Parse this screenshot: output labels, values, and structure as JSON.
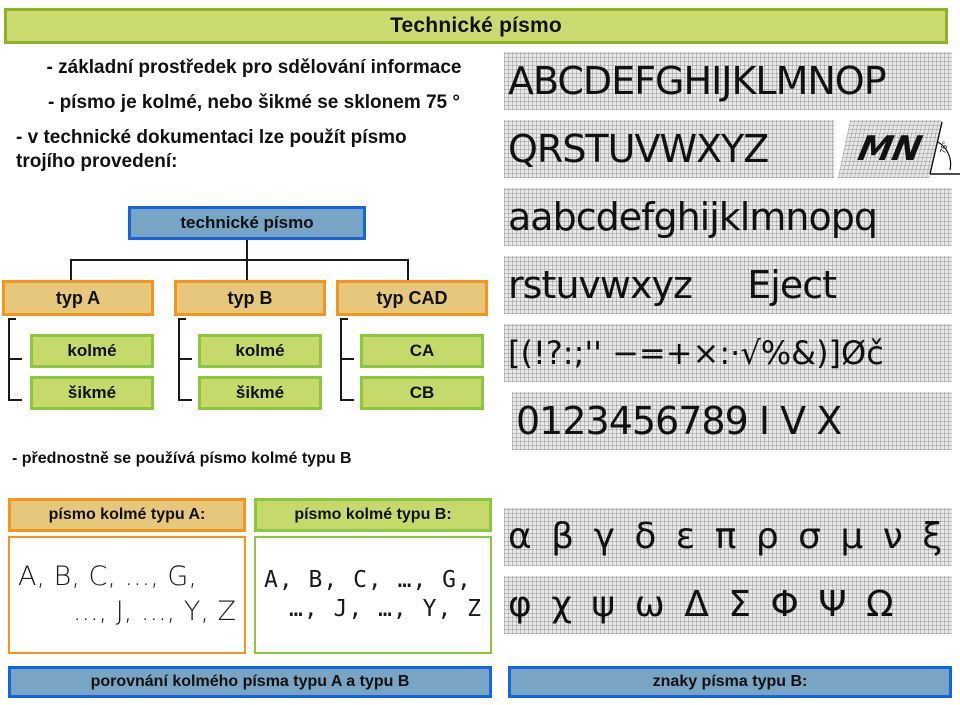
{
  "slide": {
    "title": "Technické písmo",
    "bullets": [
      "- základní prostředek pro sdělování informace",
      "- písmo je kolmé, nebo šikmé se sklonem 75 °",
      "- v technické dokumentaci lze použít písmo\ntrojího provedení:"
    ],
    "note": "- přednostně se používá písmo kolmé typu B"
  },
  "tree": {
    "root": "technické písmo",
    "types": [
      {
        "label": "typ A",
        "leaves": [
          "kolmé",
          "šikmé"
        ]
      },
      {
        "label": "typ B",
        "leaves": [
          "kolmé",
          "šikmé"
        ]
      },
      {
        "label": "typ CAD",
        "leaves": [
          "CA",
          "CB"
        ]
      }
    ]
  },
  "comparison": {
    "header_a": "písmo kolmé typu A:",
    "header_b": "písmo kolmé typu B:",
    "sample_a": [
      "A, B, C, ..., G,",
      "..., J, ..., Y, Z"
    ],
    "sample_b": [
      "A, B, C, …, G,",
      "…, J, …, Y, Z"
    ],
    "caption_left": "porovnání kolmého písma typu A a typu B",
    "caption_right": "znaky písma typu B:"
  },
  "specimens": {
    "rows": [
      "ABCDEFGHIJKLMNOP",
      "QRSTUVWXYZ",
      "aabcdefghijklmnopq",
      "rstuvwxyz     Eject",
      "[(!?:;'' −=+×:·√%&)]Øč",
      "0123456789 I V X",
      "α β γ δ ε π ρ σ μ ν ξ",
      "φ χ ψ ω Δ Σ Φ Ψ Ω"
    ],
    "slanted_sample": "MN",
    "slant_angle": "75°"
  },
  "colors": {
    "title_fill": "#ccdb6f",
    "title_border": "#8fb321",
    "blue_fill": "#78a5c3",
    "blue_border": "#1565e0",
    "orange_fill": "#e5c87c",
    "orange_border": "#f4951e",
    "green_fill": "#c6d96b",
    "green_border": "#8dc63f"
  }
}
